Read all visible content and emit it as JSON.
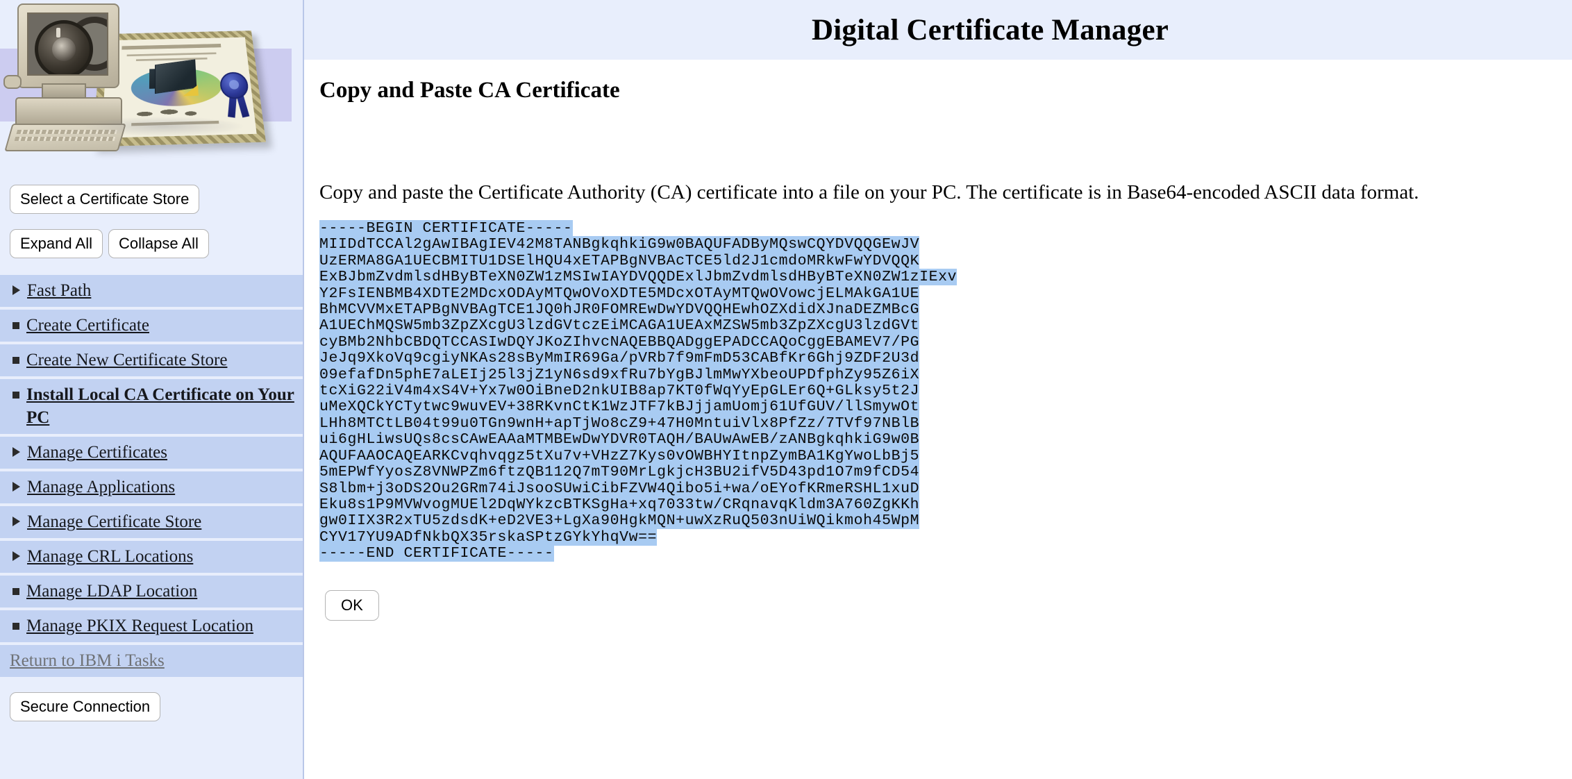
{
  "app": {
    "title": "Digital Certificate Manager"
  },
  "sidebar": {
    "select_store_button": "Select a Certificate Store",
    "expand_all_button": "Expand All",
    "collapse_all_button": "Collapse All",
    "secure_connection_button": "Secure Connection",
    "items": [
      {
        "label": "Fast Path",
        "marker": "triangle",
        "state": "normal"
      },
      {
        "label": "Create Certificate",
        "marker": "square",
        "state": "normal"
      },
      {
        "label": "Create New Certificate Store",
        "marker": "square",
        "state": "normal"
      },
      {
        "label": "Install Local CA Certificate on Your PC",
        "marker": "square",
        "state": "active"
      },
      {
        "label": "Manage Certificates",
        "marker": "triangle",
        "state": "normal"
      },
      {
        "label": "Manage Applications",
        "marker": "triangle",
        "state": "normal"
      },
      {
        "label": "Manage Certificate Store",
        "marker": "triangle",
        "state": "normal"
      },
      {
        "label": "Manage CRL Locations",
        "marker": "triangle",
        "state": "normal"
      },
      {
        "label": "Manage LDAP Location",
        "marker": "square",
        "state": "normal"
      },
      {
        "label": "Manage PKIX Request Location",
        "marker": "square",
        "state": "normal"
      },
      {
        "label": "Return to IBM i Tasks",
        "marker": "none",
        "state": "muted"
      }
    ]
  },
  "main": {
    "page_title": "Copy and Paste CA Certificate",
    "instruction": "Copy and paste the Certificate Authority (CA) certificate into a file on your PC. The certificate is in Base64-encoded ASCII data format.",
    "ok_button": "OK",
    "certificate_lines": [
      "-----BEGIN CERTIFICATE-----",
      "MIIDdTCCAl2gAwIBAgIEV42M8TANBgkqhkiG9w0BAQUFADByMQswCQYDVQQGEwJV",
      "UzERMA8GA1UECBMITU1DSElHQU4xETAPBgNVBAcTCE5ld2J1cmdoMRkwFwYDVQQK",
      "ExBJbmZvdmlsdHByBTeXN0ZW1zMSIwIAYDVQQDExlJbmZvdmlsdHByBTeXN0ZW1zIExv",
      "Y2FsIENBMB4XDTE2MDcxODAyMTQwOVoXDTE5MDcxOTAyMTQwOVowcjELMAkGA1UE",
      "BhMCVVMxETAPBgNVBAgTCE1JQ0hJR0FOMREwDwYDVQQHEwhOZXdidXJnaDEZMBcG",
      "A1UEChMQSW5mb3ZpZXcgU3lzdGVtczEiMCAGA1UEAxMZSW5mb3ZpZXcgU3lzdGVt",
      "cyBMb2NhbCBDQTCCASIwDQYJKoZIhvcNAQEBBQADggEPADCCAQoCggEBAMEV7/PG",
      "JeJq9XkoVq9cgiyNKAs28sByMmIR69Ga/pVRb7f9mFmD53CABfKr6Ghj9ZDF2U3d",
      "09efafDn5phE7aLEIj25l3jZ1yN6sd9xfRu7bYgBJlmMwYXbeoUPDfphZy95Z6iX",
      "tcXiG22iV4m4xS4V+Yx7w0OiBneD2nkUIB8ap7KT0fWqYyEpGLEr6Q+GLksy5t2J",
      "uMeXQCkYCTytwc9wuvEV+38RKvnCtK1WzJTF7kBJjjamUomj61UfGUV/llSmywOt",
      "LHh8MTCtLB04t99u0TGn9wnH+apTjWo8cZ9+47H0MntuiVlx8PfZz/7TVf97NBlB",
      "ui6gHLiwsUQs8csCAwEAAaMTMBEwDwYDVR0TAQH/BAUwAwEB/zANBgkqhkiG9w0B",
      "AQUFAAOCAQEARKCvqhvqgz5tXu7v+VHzZ7Kys0vOWBHYItnpZymBA1KgYwoLbBj5",
      "5mEPWfYyosZ8VNWPZm6ftzQB112Q7mT90MrLgkjcH3BU2ifV5D43pd1O7m9fCD54",
      "S8lbm+j3oDS2Ou2GRm74iJsooSUwiCibFZVW4Qibo5i+wa/oEYofKRmeRSHL1xuD",
      "Eku8s1P9MVWvogMUEl2DqWYkzcBTKSgHa+xq7033tw/CRqnavqKldm3A760ZgKKh",
      "gw0IIX3R2xTU5zdsdK+eD2VE3+LgXa90HgkMQN+uwXzRuQ503nUiWQikmoh45WpM",
      "CYV17YU9ADfNkbQX35rskaSPtzGYkYhqVw==",
      "-----END CERTIFICATE-----"
    ]
  }
}
